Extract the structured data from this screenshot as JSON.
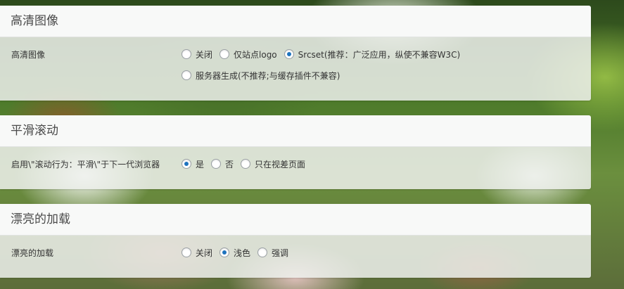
{
  "accent_color": "#1e73be",
  "sections": [
    {
      "title": "高清图像",
      "label": "高清图像",
      "options_line1": [
        "关闭",
        "仅站点logo",
        "Srcset(推荐：广泛应用，纵使不兼容W3C)"
      ],
      "options_line2": [
        "服务器生成(不推荐;与缓存插件不兼容)"
      ],
      "selected": "Srcset(推荐：广泛应用，纵使不兼容W3C)"
    },
    {
      "title": "平滑滚动",
      "label": "启用\\\"滚动行为：平滑\\\"于下一代浏览器",
      "options_line1": [
        "是",
        "否",
        "只在视差页面"
      ],
      "selected": "是"
    },
    {
      "title": "漂亮的加载",
      "label": "漂亮的加载",
      "options_line1": [
        "关闭",
        "浅色",
        "强调"
      ],
      "selected": "浅色"
    }
  ]
}
